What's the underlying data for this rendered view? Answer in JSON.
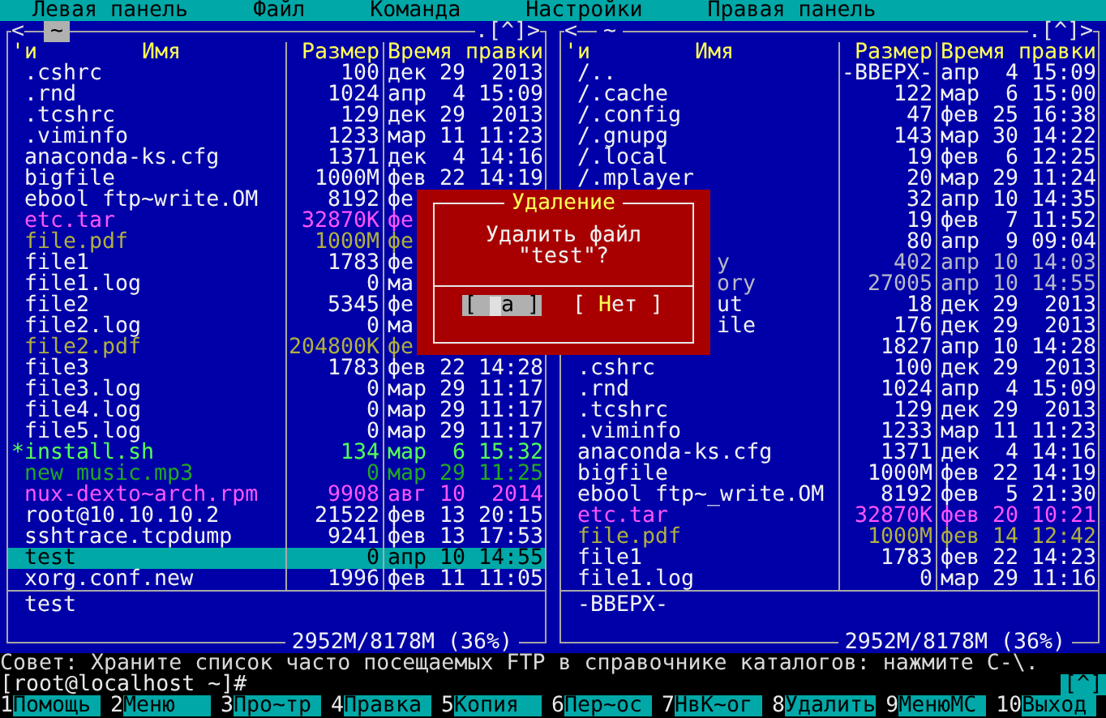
{
  "menu_bar": [
    "Левая панель",
    "Файл",
    "Команда",
    "Настройки",
    "Правая панель"
  ],
  "panels": [
    {
      "active": true,
      "history": "<",
      "path": "~",
      "controls": ".[^]>",
      "columns": {
        "mark": "'и",
        "name": "Имя",
        "size": "Размер",
        "modified": "Время правки"
      },
      "files": [
        {
          "name": ".cshrc",
          "size": "100",
          "modified": "дек 29  2013",
          "kind": "file",
          "selected": false
        },
        {
          "name": ".rnd",
          "size": "1024",
          "modified": "апр  4 15:09",
          "kind": "file",
          "selected": false
        },
        {
          "name": ".tcshrc",
          "size": "129",
          "modified": "дек 29  2013",
          "kind": "file",
          "selected": false
        },
        {
          "name": ".viminfo",
          "size": "1233",
          "modified": "мар 11 11:23",
          "kind": "file",
          "selected": false
        },
        {
          "name": "anaconda-ks.cfg",
          "size": "1371",
          "modified": "дек  4 14:16",
          "kind": "file",
          "selected": false
        },
        {
          "name": "bigfile",
          "size": "1000M",
          "modified": "фев 22 14:19",
          "kind": "file",
          "selected": false
        },
        {
          "name": "ebool ftp~write.OM",
          "size": "8192",
          "modified": "фе",
          "kind": "file",
          "selected": false
        },
        {
          "name": "etc.tar",
          "size": "32870K",
          "modified": "фе",
          "kind": "archive",
          "selected": false
        },
        {
          "name": "file.pdf",
          "size": "1000M",
          "modified": "фе",
          "kind": "doc",
          "selected": false
        },
        {
          "name": "file1",
          "size": "1783",
          "modified": "фе",
          "kind": "file",
          "selected": false
        },
        {
          "name": "file1.log",
          "size": "0",
          "modified": "ма",
          "kind": "file",
          "selected": false
        },
        {
          "name": "file2",
          "size": "5345",
          "modified": "фе",
          "kind": "file",
          "selected": false
        },
        {
          "name": "file2.log",
          "size": "0",
          "modified": "ма",
          "kind": "file",
          "selected": false
        },
        {
          "name": "file2.pdf",
          "size": "204800K",
          "modified": "фе",
          "kind": "doc",
          "selected": false
        },
        {
          "name": "file3",
          "size": "1783",
          "modified": "фев 22 14:28",
          "kind": "file",
          "selected": false
        },
        {
          "name": "file3.log",
          "size": "0",
          "modified": "мар 29 11:17",
          "kind": "file",
          "selected": false
        },
        {
          "name": "file4.log",
          "size": "0",
          "modified": "мар 29 11:17",
          "kind": "file",
          "selected": false
        },
        {
          "name": "file5.log",
          "size": "0",
          "modified": "мар 29 11:17",
          "kind": "file",
          "selected": false
        },
        {
          "mark": "*",
          "name": "install.sh",
          "size": "134",
          "modified": "мар  6 15:32",
          "kind": "exec",
          "selected": false
        },
        {
          "name": "new music.mp3",
          "size": "0",
          "modified": "мар 29 11:25",
          "kind": "media",
          "selected": false
        },
        {
          "name": "nux-dexto~arch.rpm",
          "size": "9908",
          "modified": "авг 10  2014",
          "kind": "package",
          "selected": false
        },
        {
          "name": "root@10.10.10.2",
          "size": "21522",
          "modified": "фев 13 20:15",
          "kind": "file",
          "selected": false
        },
        {
          "name": "sshtrace.tcpdump",
          "size": "9241",
          "modified": "фев 13 17:53",
          "kind": "file",
          "selected": false
        },
        {
          "name": "test",
          "size": "0",
          "modified": "апр 10 14:55",
          "kind": "file",
          "selected": true
        },
        {
          "name": "xorg.conf.new",
          "size": "1996",
          "modified": "фев 11 11:05",
          "kind": "file",
          "selected": false
        }
      ],
      "mini_status": "test",
      "disk_usage": "2952M/8178M (36%)"
    },
    {
      "active": false,
      "history": "<",
      "path": "~",
      "controls": ".[^]>",
      "columns": {
        "mark": "'и",
        "name": "Имя",
        "size": "Размер",
        "modified": "Время правки"
      },
      "files": [
        {
          "name": "/..",
          "size": "-ВВЕРХ-",
          "modified": "апр  4 15:09",
          "kind": "dir",
          "selected": false
        },
        {
          "name": "/.cache",
          "size": "122",
          "modified": "мар  6 15:00",
          "kind": "dir",
          "selected": false
        },
        {
          "name": "/.config",
          "size": "47",
          "modified": "фев 25 16:38",
          "kind": "dir",
          "selected": false
        },
        {
          "name": "/.gnupg",
          "size": "143",
          "modified": "мар 30 14:22",
          "kind": "dir",
          "selected": false
        },
        {
          "name": "/.local",
          "size": "19",
          "modified": "фев  6 12:25",
          "kind": "dir",
          "selected": false
        },
        {
          "name": "/.mplayer",
          "size": "20",
          "modified": "мар 29 11:24",
          "kind": "dir",
          "selected": false
        },
        {
          "size": "32",
          "modified": "апр 10 14:35",
          "kind": "dir",
          "selected": false
        },
        {
          "size": "19",
          "modified": "фев  7 11:52",
          "kind": "dir",
          "selected": false
        },
        {
          "size": "80",
          "modified": "апр  9 09:04",
          "kind": "dir",
          "selected": false
        },
        {
          "name": "y",
          "size": "402",
          "modified": "апр 10 14:03",
          "kind": "dim",
          "selected": false
        },
        {
          "name": "ory",
          "size": "27005",
          "modified": "апр 10 14:55",
          "kind": "dim",
          "selected": false
        },
        {
          "name": "ut",
          "size": "18",
          "modified": "дек 29  2013",
          "kind": "file",
          "selected": false
        },
        {
          "name": "ile",
          "size": "176",
          "modified": "дек 29  2013",
          "kind": "file",
          "selected": false
        },
        {
          "size": "1827",
          "modified": "апр 10 14:28",
          "kind": "file",
          "selected": false
        },
        {
          "name": ".cshrc",
          "size": "100",
          "modified": "дек 29  2013",
          "kind": "file",
          "selected": false
        },
        {
          "name": ".rnd",
          "size": "1024",
          "modified": "апр  4 15:09",
          "kind": "file",
          "selected": false
        },
        {
          "name": ".tcshrc",
          "size": "129",
          "modified": "дек 29  2013",
          "kind": "file",
          "selected": false
        },
        {
          "name": ".viminfo",
          "size": "1233",
          "modified": "мар 11 11:23",
          "kind": "file",
          "selected": false
        },
        {
          "name": "anaconda-ks.cfg",
          "size": "1371",
          "modified": "дек  4 14:16",
          "kind": "file",
          "selected": false
        },
        {
          "name": "bigfile",
          "size": "1000M",
          "modified": "фев 22 14:19",
          "kind": "file",
          "selected": false
        },
        {
          "name": "ebool ftp~_write.OM",
          "size": "8192",
          "modified": "фев  5 21:30",
          "kind": "file",
          "selected": false
        },
        {
          "name": "etc.tar",
          "size": "32870K",
          "modified": "фев 20 10:21",
          "kind": "archive",
          "selected": false
        },
        {
          "name": "file.pdf",
          "size": "1000M",
          "modified": "фев 14 12:42",
          "kind": "doc",
          "selected": false
        },
        {
          "name": "file1",
          "size": "1783",
          "modified": "фев 22 14:23",
          "kind": "file",
          "selected": false
        },
        {
          "name": "file1.log",
          "size": "0",
          "modified": "мар 29 11:16",
          "kind": "file",
          "selected": false
        }
      ],
      "mini_status": "-ВВЕРХ-",
      "disk_usage": "2952M/8178M (36%)"
    }
  ],
  "dialog": {
    "title": "Удаление",
    "message": [
      "Удалить файл",
      "\"test\"?"
    ],
    "buttons": [
      {
        "before": "[ ",
        "after": "а ]",
        "selected": true
      },
      {
        "before": "[ ",
        "hotkey": "Н",
        "after": "ет ]",
        "selected": false
      }
    ]
  },
  "tip": "Совет: Храните список часто посещаемых FTP в справочнике каталогов: нажмите C-\\.",
  "prompt": "[root@localhost ~]#",
  "prompt_button": "[^]",
  "function_keys": [
    {
      "key": "1",
      "label": "Помощь"
    },
    {
      "key": "2",
      "label": "Меню"
    },
    {
      "key": "3",
      "label": "Про~тр"
    },
    {
      "key": "4",
      "label": "Правка"
    },
    {
      "key": "5",
      "label": "Копия"
    },
    {
      "key": "6",
      "label": "Пер~ос"
    },
    {
      "key": "7",
      "label": "НвК~ог"
    },
    {
      "key": "8",
      "label": "Удалить"
    },
    {
      "key": "9",
      "label": "МенюМС"
    },
    {
      "key": "10",
      "label": "Выход"
    }
  ]
}
